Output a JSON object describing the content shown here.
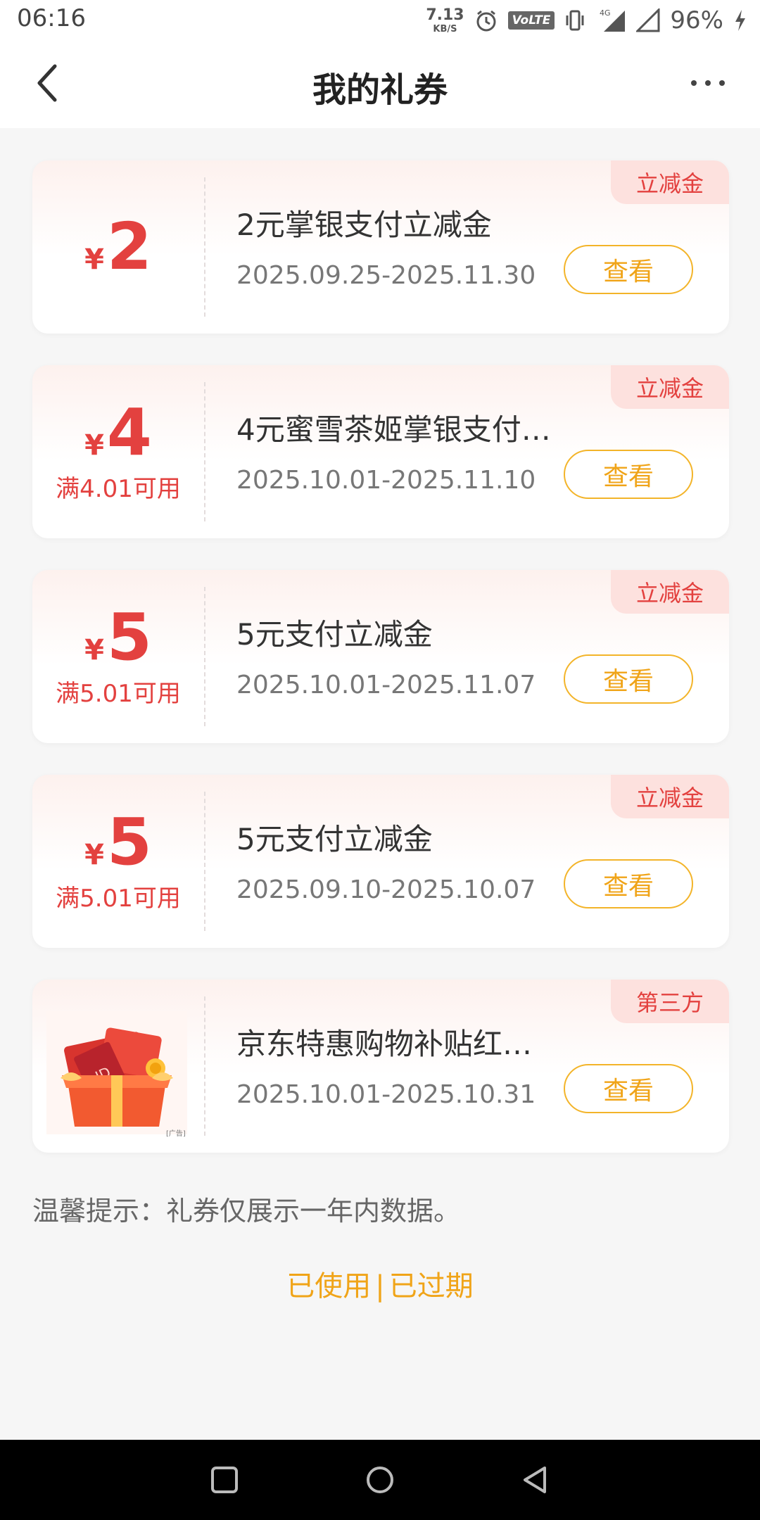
{
  "status_bar": {
    "time": "06:16",
    "net_speed_value": "7.13",
    "net_speed_unit": "KB/S",
    "volte": "VoLTE",
    "network": "4G",
    "battery": "96%"
  },
  "header": {
    "title": "我的礼券"
  },
  "coupons": [
    {
      "tag": "立减金",
      "yen": "¥",
      "amount": "2",
      "condition": "",
      "name": "2元掌银支付立减金",
      "date": "2025.09.25-2025.11.30",
      "button": "查看"
    },
    {
      "tag": "立减金",
      "yen": "¥",
      "amount": "4",
      "condition": "满4.01可用",
      "name": "4元蜜雪茶姬掌银支付…",
      "date": "2025.10.01-2025.11.10",
      "button": "查看"
    },
    {
      "tag": "立减金",
      "yen": "¥",
      "amount": "5",
      "condition": "满5.01可用",
      "name": "5元支付立减金",
      "date": "2025.10.01-2025.11.07",
      "button": "查看"
    },
    {
      "tag": "立减金",
      "yen": "¥",
      "amount": "5",
      "condition": "满5.01可用",
      "name": "5元支付立减金",
      "date": "2025.09.10-2025.10.07",
      "button": "查看"
    },
    {
      "tag": "第三方",
      "name": "京东特惠购物补贴红…",
      "date": "2025.10.01-2025.10.31",
      "button": "查看",
      "ad_label": "[广告]"
    }
  ],
  "tip": "温馨提示：礼券仅展示一年内数据。",
  "links": {
    "used": "已使用",
    "separator": "|",
    "expired": "已过期"
  },
  "colors": {
    "accent_red": "#e3413f",
    "button_orange": "#f0a418",
    "tag_bg": "#fde1de"
  }
}
